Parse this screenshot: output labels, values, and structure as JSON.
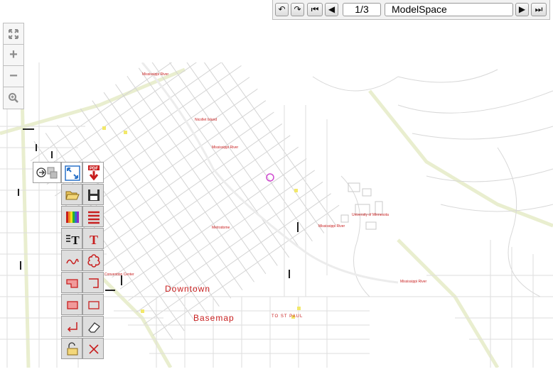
{
  "navigation": {
    "page_indicator": "1/3",
    "space_name": "ModelSpace"
  },
  "zoom_controls": {
    "fit": "fit-extents-icon",
    "in": "+",
    "out": "−",
    "window": "zoom-window-icon"
  },
  "map": {
    "labels": {
      "downtown": "Downtown",
      "basemap": "Basemap",
      "to_st_paul": "TO ST PAUL",
      "mississippi_1": "Mississippi River",
      "mississippi_2": "Mississippi River",
      "mississippi_3": "Mississippi River",
      "mississippi_4": "Mississippi River",
      "nicollet": "Nicollet Island",
      "metrodome": "Metrodome",
      "university": "University of Minnesota",
      "convention": "Convention Center"
    }
  },
  "colors": {
    "markup_red": "#c81e1e",
    "street_line": "#cfcfcf",
    "toolbar_bg": "#dedede"
  }
}
